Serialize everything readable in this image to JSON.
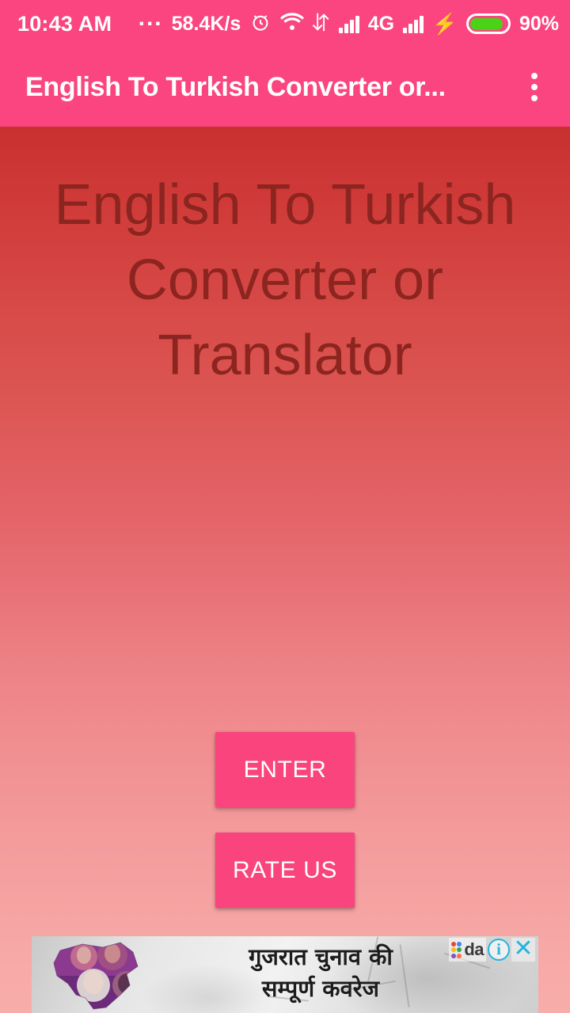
{
  "status_bar": {
    "clock": "10:43 AM",
    "ellipsis": "...",
    "network_speed": "58.4K/s",
    "alarm_icon": "alarm-clock-icon",
    "wifi_icon": "wifi-icon",
    "data_transfer_icon": "data-transfer-icon",
    "signal_icon_1": "signal-bars-icon",
    "network_type": "4G",
    "signal_icon_2": "signal-bars-icon",
    "charging_icon": "lightning-bolt-icon",
    "battery_icon": "battery-icon",
    "battery_percent": "90%",
    "background_color": "#fa4580",
    "foreground_color": "#ffffff",
    "battery_fill_color": "#4ad216"
  },
  "app_bar": {
    "title": "English To Turkish Converter or...",
    "overflow_icon": "overflow-menu-icon",
    "background_color": "#fa4580"
  },
  "main": {
    "headline": "English To Turkish Converter or Translator",
    "headline_color": "#8c2520",
    "gradient_top_color": "#c93030",
    "gradient_bottom_color": "#f8adab",
    "buttons": [
      {
        "label": "ENTER",
        "name": "enter-button",
        "color": "#f9447d"
      },
      {
        "label": "RATE US",
        "name": "rate-us-button",
        "color": "#f9447d"
      }
    ]
  },
  "ad_banner": {
    "headline_line1": "गुजरात चुनाव की",
    "headline_line2": "सम्पूर्ण कवरेज",
    "brand_label": "da",
    "brand_icon": "dailyhunt-logo-icon",
    "info_icon": "ad-info-icon",
    "info_glyph": "i",
    "close_icon": "ad-close-icon",
    "close_glyph": "✕",
    "accent_color": "#24b4e0",
    "image_alt": "gujarat-map-with-politicians"
  }
}
